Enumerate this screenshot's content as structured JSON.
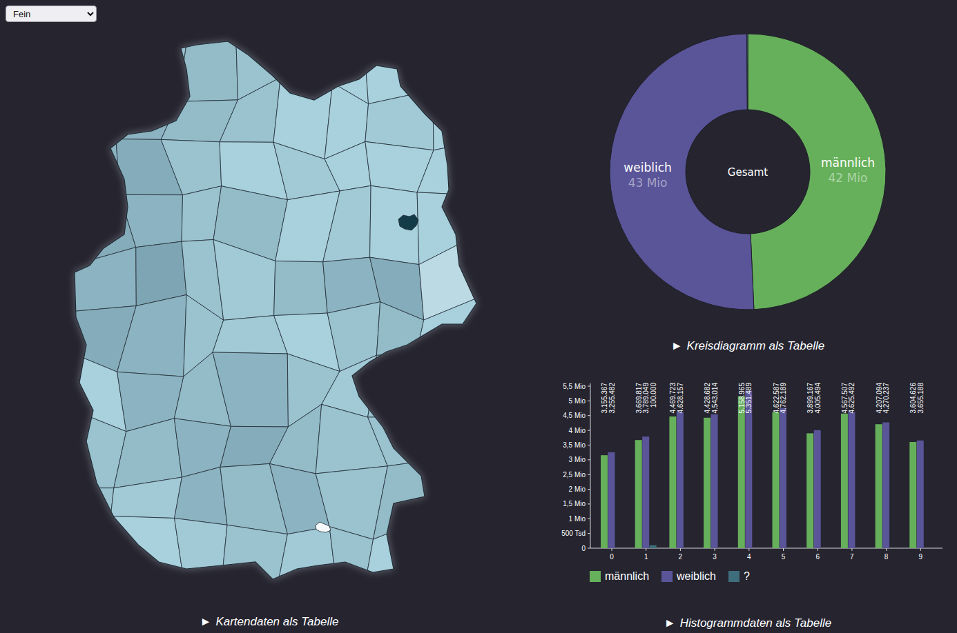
{
  "controls": {
    "granularity": {
      "value": "Fein"
    }
  },
  "map": {
    "cells": [
      0.3,
      0.3,
      0.35,
      0.3,
      0.2,
      0.2,
      0.2,
      0.2,
      0.3,
      0.4,
      0.35,
      0.3,
      0.2,
      0.2,
      0.25,
      0.2,
      0.4,
      0.45,
      0.3,
      0.2,
      0.25,
      0.2,
      0.2,
      0.2,
      0.45,
      0.4,
      0.3,
      0.35,
      0.2,
      0.25,
      0.2,
      0.2,
      0.4,
      0.5,
      0.3,
      0.25,
      0.35,
      0.4,
      0.45,
      0.15,
      0.45,
      0.4,
      0.3,
      0.25,
      0.2,
      0.3,
      0.35,
      0.2,
      0.2,
      0.4,
      0.35,
      0.4,
      0.3,
      0.25,
      0.3,
      0.2,
      0.3,
      0.35,
      0.4,
      0.45,
      0.35,
      0.3,
      0.3,
      0.2,
      0.3,
      0.25,
      0.4,
      0.35,
      0.4,
      0.3,
      0.35,
      0.3,
      0.2,
      0.2,
      0.25,
      0.3,
      0.25,
      0.3,
      0.2,
      0.2
    ],
    "cities": [
      {
        "level": 1.0
      },
      {
        "level": 0.0
      }
    ],
    "caption": {
      "marker": "►",
      "label": "Kartendaten als Tabelle"
    }
  },
  "pie": {
    "center": "Gesamt",
    "slices": [
      {
        "label": "männlich",
        "reading": "42 Mio",
        "value": 41783535,
        "color": "#67b05b"
      },
      {
        "label": "weiblich",
        "reading": "43 Mio",
        "value": 42885791,
        "color": "#5a5598"
      },
      {
        "value": 100000,
        "color": "#3e6e7b"
      }
    ],
    "caption": {
      "marker": "►",
      "label": "Kreisdiagramm als Tabelle"
    }
  },
  "histogram": {
    "ticks": [
      {
        "label": "0",
        "value": 0
      },
      {
        "label": "500 Tsd",
        "value": 500000
      },
      {
        "label": "1 Mio",
        "value": 1000000
      },
      {
        "label": "1,5 Mio",
        "value": 1500000
      },
      {
        "label": "2 Mio",
        "value": 2000000
      },
      {
        "label": "2,5 Mio",
        "value": 2500000
      },
      {
        "label": "3 Mio",
        "value": 3000000
      },
      {
        "label": "3,5 Mio",
        "value": 3500000
      },
      {
        "label": "4 Mio",
        "value": 4000000
      },
      {
        "label": "4,5 Mio",
        "value": 4500000
      },
      {
        "label": "5 Mio",
        "value": 5000000
      },
      {
        "label": "5,5 Mio",
        "value": 5500000
      }
    ],
    "categories": [
      "0",
      "1",
      "2",
      "3",
      "4",
      "5",
      "6",
      "7",
      "8",
      "9"
    ],
    "series": [
      {
        "name": "männlich",
        "color": "#67b05b",
        "values": [
          3155367,
          3669817,
          4469723,
          4428682,
          5158965,
          4622587,
          3899167,
          4567507,
          4207094,
          3604626
        ],
        "labels": [
          "3.155.367",
          "3.669.817",
          "4.469.723",
          "4.428.682",
          "5.158.965",
          "4.622.587",
          "3.899.167",
          "4.567.507",
          "4.207.094",
          "3.604.626"
        ]
      },
      {
        "name": "weiblich",
        "color": "#5a5598",
        "values": [
          3255482,
          3789049,
          4628157,
          4543014,
          5351489,
          4762189,
          4005494,
          4625492,
          4270237,
          3655188
        ],
        "labels": [
          "3.255.482",
          "3.789.049",
          "4.628.157",
          "4.543.014",
          "5.351.489",
          "4.762.189",
          "4.005.494",
          "4.625.492",
          "4.270.237",
          "3.655.188"
        ]
      },
      {
        "name": "?",
        "color": "#3e6e7b",
        "values": [
          0,
          100000,
          0,
          0,
          0,
          0,
          0,
          0,
          0,
          0
        ],
        "labels": [
          "",
          "100.000",
          "",
          "",
          "",
          "",
          "",
          "",
          "",
          ""
        ]
      }
    ],
    "caption": {
      "marker": "►",
      "label": "Histogrammdaten als Tabelle"
    }
  }
}
